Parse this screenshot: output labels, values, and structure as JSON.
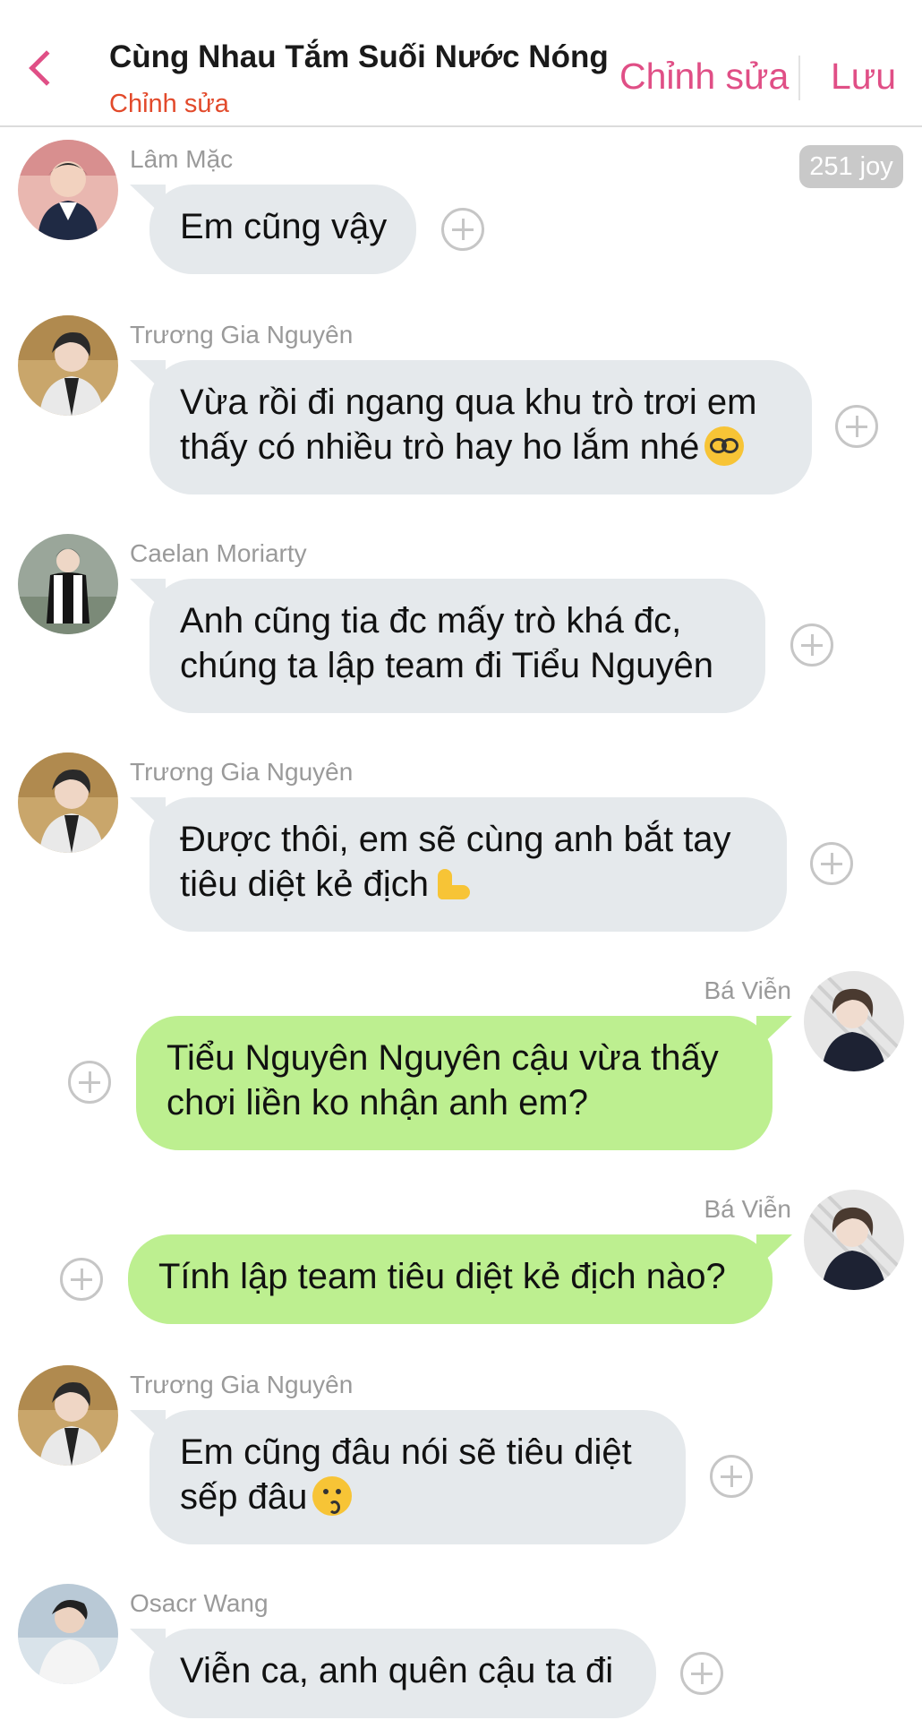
{
  "header": {
    "title": "Cùng Nhau Tắm Suối Nước Nóng",
    "subtitle": "Chỉnh sửa",
    "edit_label": "Chỉnh sửa",
    "save_label": "Lưu"
  },
  "joy_badge": "251 joy",
  "messages": [
    {
      "sender": "Lâm Mặc",
      "line1": "Em cũng vậy",
      "line2": "",
      "emoji": "",
      "side": "incoming"
    },
    {
      "sender": "Trương Gia Nguyên",
      "line1": "Vừa rồi đi ngang qua khu trò trơi em",
      "line2": "thấy có nhiều trò hay ho lắm nhé",
      "emoji": "nerd-face-emoji",
      "side": "incoming"
    },
    {
      "sender": "Caelan Moriarty",
      "line1": "Anh cũng tia đc mấy trò khá đc,",
      "line2": "chúng ta lập team đi Tiểu Nguyên",
      "emoji": "",
      "side": "incoming"
    },
    {
      "sender": "Trương Gia Nguyên",
      "line1": "Được thôi, em sẽ cùng anh bắt tay",
      "line2": "tiêu diệt kẻ địch",
      "emoji": "flexed-biceps-emoji",
      "side": "incoming"
    },
    {
      "sender": "Bá Viễn",
      "line1": "Tiểu Nguyên Nguyên cậu vừa thấy",
      "line2": "chơi liền ko nhận anh em?",
      "emoji": "",
      "side": "outgoing"
    },
    {
      "sender": "Bá Viễn",
      "line1": "Tính lập team tiêu diệt kẻ địch nào?",
      "line2": "",
      "emoji": "",
      "side": "outgoing"
    },
    {
      "sender": "Trương Gia Nguyên",
      "line1": "Em cũng đâu nói sẽ tiêu diệt",
      "line2": "sếp đâu",
      "emoji": "kissing-face-emoji",
      "side": "incoming"
    },
    {
      "sender": "Osacr Wang",
      "line1": "Viễn ca, anh quên cậu ta đi",
      "line2": "",
      "emoji": "",
      "side": "incoming"
    }
  ],
  "colors": {
    "accent": "#e04f86",
    "subtitle": "#e24a2b",
    "incoming_bubble": "#e5e9ec",
    "outgoing_bubble": "#bdef90"
  }
}
